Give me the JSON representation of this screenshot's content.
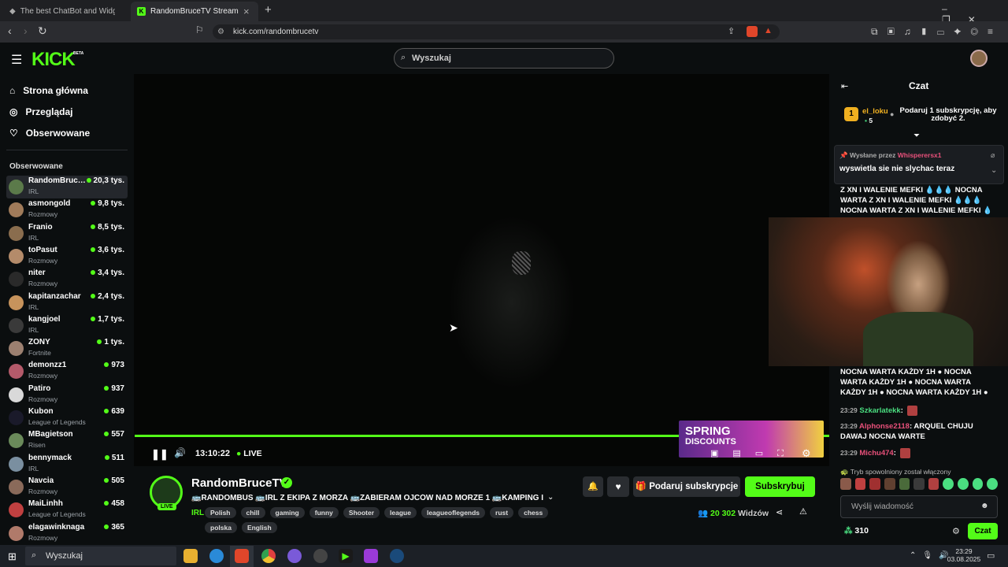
{
  "browser": {
    "tabs": [
      {
        "title": "The best ChatBot and Widgets fo"
      },
      {
        "title": "RandomBruceTV Stream - Wa"
      }
    ],
    "url": "kick.com/randombrucetv"
  },
  "site": {
    "logo": "KICK",
    "logo_badge": "BETA",
    "search_placeholder": "Wyszukaj"
  },
  "sidebar": {
    "nav": [
      {
        "label": "Strona główna",
        "icon": "home-icon"
      },
      {
        "label": "Przeglądaj",
        "icon": "compass-icon"
      },
      {
        "label": "Obserwowane",
        "icon": "heart-icon"
      }
    ],
    "section_title": "Obserwowane",
    "channels": [
      {
        "name": "RandomBruce...",
        "category": "IRL",
        "viewers": "20,3 tys.",
        "color": "#5b7a4a"
      },
      {
        "name": "asmongold",
        "category": "Rozmowy",
        "viewers": "9,8 tys.",
        "color": "#a07b5a"
      },
      {
        "name": "Franio",
        "category": "IRL",
        "viewers": "8,5 tys.",
        "color": "#8a6d4e"
      },
      {
        "name": "toPasut",
        "category": "Rozmowy",
        "viewers": "3,6 tys.",
        "color": "#b48b6a"
      },
      {
        "name": "niter",
        "category": "Rozmowy",
        "viewers": "3,4 tys.",
        "color": "#2a2a2a"
      },
      {
        "name": "kapitanzachar",
        "category": "IRL",
        "viewers": "2,4 tys.",
        "color": "#c7935c"
      },
      {
        "name": "kangjoel",
        "category": "IRL",
        "viewers": "1,7 tys.",
        "color": "#3a3a3a"
      },
      {
        "name": "ZONY",
        "category": "Fortnite",
        "viewers": "1 tys.",
        "color": "#9c8070"
      },
      {
        "name": "demonzz1",
        "category": "Rozmowy",
        "viewers": "973",
        "color": "#b45a6a"
      },
      {
        "name": "Patiro",
        "category": "Rozmowy",
        "viewers": "937",
        "color": "#d9d9d9"
      },
      {
        "name": "Kubon",
        "category": "League of Legends",
        "viewers": "639",
        "color": "#1a1a2a"
      },
      {
        "name": "MBagietson",
        "category": "Risen",
        "viewers": "557",
        "color": "#6a8a5a"
      },
      {
        "name": "bennymack",
        "category": "IRL",
        "viewers": "511",
        "color": "#7a8fa0"
      },
      {
        "name": "Navcia",
        "category": "Rozmowy",
        "viewers": "505",
        "color": "#8a6a5a"
      },
      {
        "name": "MaiLinhh",
        "category": "League of Legends",
        "viewers": "458",
        "color": "#c04040"
      },
      {
        "name": "elagawinknaga",
        "category": "Rozmowy",
        "viewers": "365",
        "color": "#b07a6a"
      }
    ]
  },
  "player": {
    "time": "13:10:22",
    "live_label": "LIVE",
    "ad_line1": "SPRING",
    "ad_line2": "DISCOUNTS",
    "progress": 1.0
  },
  "channel": {
    "name": "RandomBruceTV",
    "live_badge": "LIVE",
    "title": "🚌RANDOMBUS 🚌IRL Z EKIPA Z MORZA 🚌ZABIERAM OJCÓW NAD MORZE 1 🚌KAMPING I NA...",
    "category": "IRL",
    "tags": [
      "Polish",
      "chill",
      "gaming",
      "funny",
      "Shooter",
      "league",
      "leagueoflegends",
      "rust",
      "chess",
      "polska",
      "English"
    ],
    "viewers": "20 302",
    "viewers_label": "Widzów",
    "gift_button": "Podaruj subskrypcje",
    "subscribe_button": "Subskrybuj"
  },
  "chat": {
    "title": "Czat",
    "leader_rank": "1",
    "leader_name": "el_loku",
    "leader_count": "5",
    "gift_prompt": "Podaruj 1 subskrypcję, aby zdobyć 2.",
    "pinned_by_label": "Wysłane przez",
    "pinned_user": "Whisperersx1",
    "pinned_text": "wyswietla sie nie slychac teraz",
    "spam1": "Z XN I WALENIE MEFKI 💧💧💧 NOCNA WARTA Z XN I WALENIE MEFKI 💧💧💧 NOCNA WARTA Z XN I WALENIE MEFKI 💧",
    "spam2": "NOCNA WARTA KAŻDY 1H ● NOCNA WARTA KAŻDY 1H ● NOCNA WARTA KAŻDY 1H ● NOCNA WARTA KAŻDY 1H ●",
    "messages": [
      {
        "time": "23:29",
        "user": "Szkarlatekk",
        "text": "",
        "color": "#4ade80"
      },
      {
        "time": "23:29",
        "user": "Alphonse2118",
        "text": "ARQUEL CHUJU DAWAJ NOCNA WARTE",
        "color": "#e8507a"
      },
      {
        "time": "23:29",
        "user": "Michu474",
        "text": "",
        "color": "#e8507a"
      }
    ],
    "slow_mode": "Tryb spowolniony został włączony",
    "input_placeholder": "Wyślij wiadomość",
    "points": "310",
    "send_button": "Czat"
  },
  "taskbar": {
    "search_placeholder": "Wyszukaj",
    "time": "23:29",
    "date": "03.08.2025"
  },
  "colors": {
    "accent": "#53fc18"
  }
}
